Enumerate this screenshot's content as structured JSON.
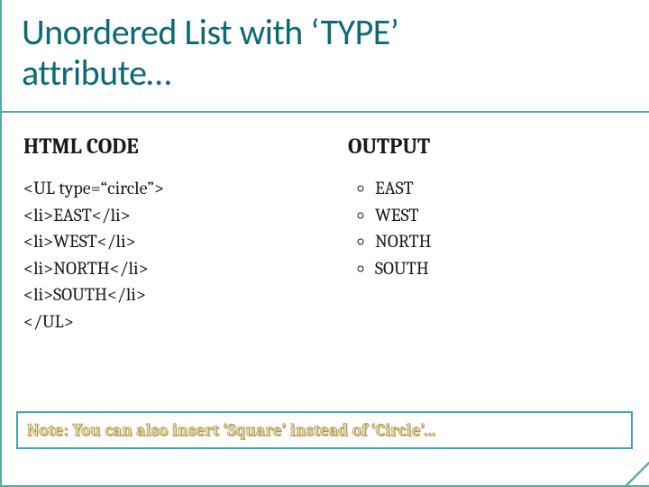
{
  "title": {
    "line1": "Unordered List with ‘TYPE’",
    "line2": "attribute…"
  },
  "left": {
    "heading": "HTML CODE",
    "code": [
      "<UL type=“circle”>",
      "<li>EAST</li>",
      "<li>WEST</li>",
      "<li>NORTH</li>",
      "<li>SOUTH</li>",
      "</UL>"
    ]
  },
  "right": {
    "heading": "OUTPUT",
    "items": [
      "EAST",
      "WEST",
      "NORTH",
      "SOUTH"
    ]
  },
  "note": "Note: You can also insert ‘Square’ instead of ‘Circle’…"
}
